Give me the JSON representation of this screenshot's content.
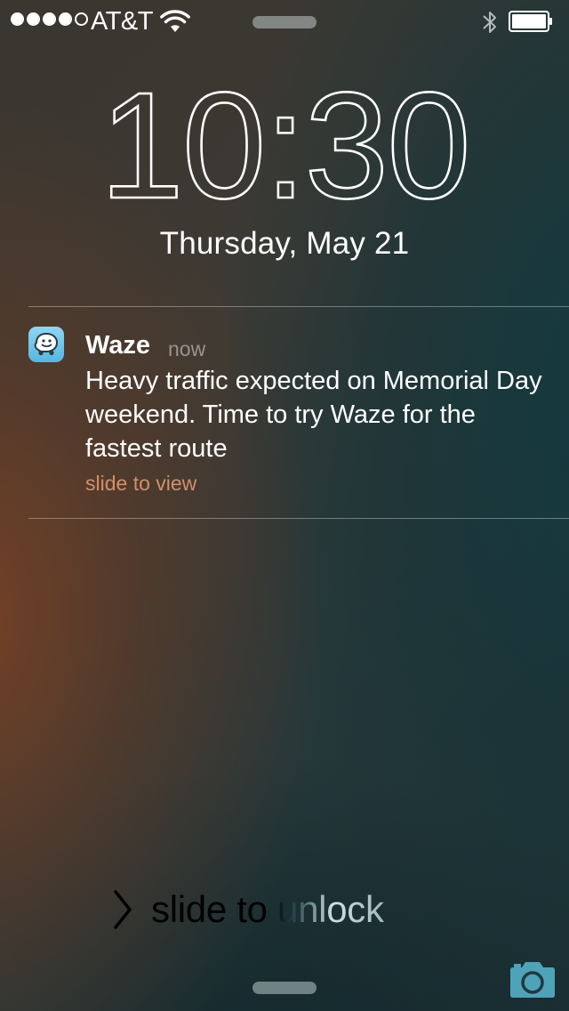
{
  "status_bar": {
    "signal_dots": [
      true,
      true,
      true,
      true,
      false
    ],
    "carrier": "AT&T",
    "icons": [
      "wifi-icon",
      "bluetooth-icon",
      "battery-icon"
    ]
  },
  "lock_screen": {
    "time": "10:30",
    "date": "Thursday, May 21"
  },
  "notification": {
    "app_name": "Waze",
    "time": "now",
    "body": "Heavy traffic expected on Memorial Day weekend. Time to try Waze for the fastest route",
    "action": "slide to view",
    "icon": "waze-app-icon"
  },
  "unlock": {
    "label": "slide to unlock",
    "icon": "chevron-right-icon"
  },
  "camera": {
    "icon": "camera-icon",
    "color": "#4fa3b8"
  }
}
